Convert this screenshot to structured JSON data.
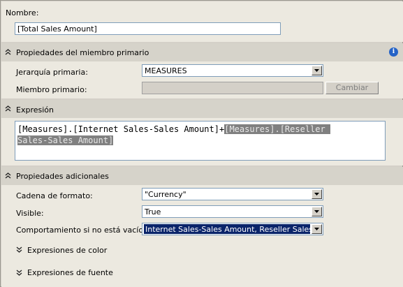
{
  "name_section": {
    "label": "Nombre:",
    "value": "[Total Sales Amount]"
  },
  "parent_properties": {
    "header": "Propiedades del miembro primario",
    "hierarchy_label": "Jerarquía primaria:",
    "hierarchy_value": "MEASURES",
    "parent_member_label": "Miembro primario:",
    "parent_member_value": "",
    "change_button": "Cambiar"
  },
  "expression": {
    "header": "Expresión",
    "line1_plain": "[Measures].[Internet Sales-Sales Amount]+",
    "line1_selected": "[Measures].[Reseller ",
    "line2_selected": "Sales-Sales Amount]"
  },
  "additional_properties": {
    "header": "Propiedades adicionales",
    "format_label": "Cadena de formato:",
    "format_value": "\"Currency\"",
    "visible_label": "Visible:",
    "visible_value": "True",
    "nonempty_label": "Comportamiento si no está vacío:",
    "nonempty_value": "Internet Sales-Sales Amount, Reseller Sales-S...",
    "color_expressions": "Expresiones de color",
    "font_expressions": "Expresiones de fuente"
  },
  "icons": {
    "collapse": "double-chevron-up-icon",
    "expand": "double-chevron-down-icon",
    "info": "info-icon",
    "dropdown": "dropdown-arrow-icon"
  },
  "colors": {
    "selection": "#0a246a",
    "expression_highlight": "#808080",
    "info": "#2563c7"
  }
}
